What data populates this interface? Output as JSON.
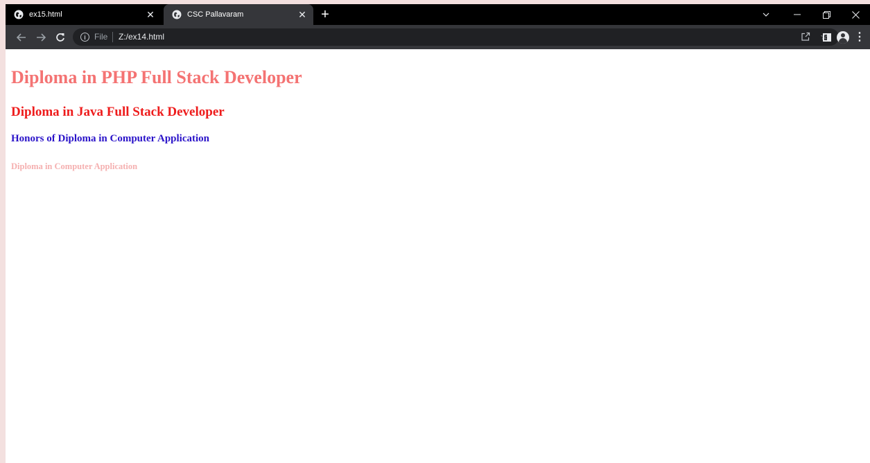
{
  "browser": {
    "tabs": [
      {
        "title": "ex15.html",
        "active": false
      },
      {
        "title": "CSC Pallavaram",
        "active": true
      }
    ],
    "address_bar": {
      "scheme_label": "File",
      "url": "Z:/ex14.html"
    }
  },
  "page": {
    "headings": [
      {
        "text": "Diploma in PHP Full Stack Developer",
        "color": "#f47373"
      },
      {
        "text": "Diploma in Java Full Stack Developer",
        "color": "#ee1c1c"
      },
      {
        "text": "Honors of Diploma in Computer Application",
        "color": "#2a13c9"
      },
      {
        "text": "Diploma in Computer Application",
        "color": "#f5b0b0"
      }
    ]
  }
}
